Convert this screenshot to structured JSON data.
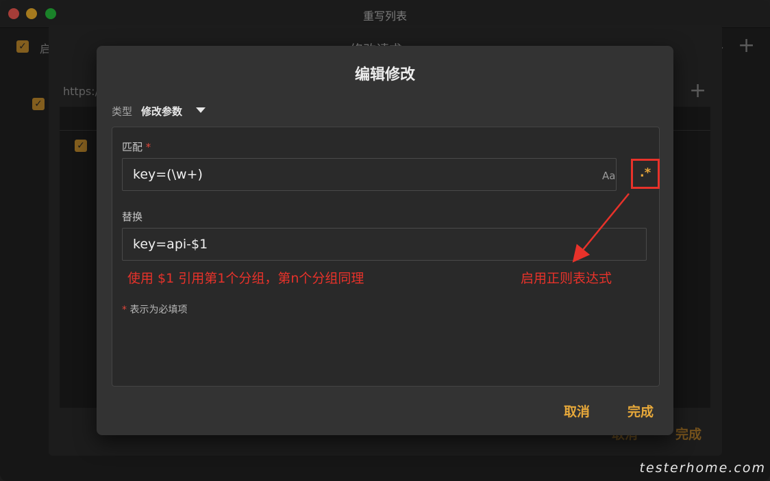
{
  "window": {
    "title": "重写列表"
  },
  "background": {
    "enable_label": "启",
    "url_label": "https:/",
    "trailing_label": "分",
    "ghost_cancel": "取消",
    "ghost_done": "完成",
    "sheet_title": "修改请求"
  },
  "dialog": {
    "title": "编辑修改",
    "type_label": "类型",
    "type_value": "修改参数",
    "match_label": "匹配",
    "required_mark": "*",
    "match_value": "key=(\\w+)",
    "case_toggle": "Aa",
    "regex_toggle": ".*",
    "replace_label": "替换",
    "replace_value": "key=api-$1",
    "required_note": "表示为必填项",
    "cancel_label": "取消",
    "done_label": "完成"
  },
  "annotations": {
    "left_note": "使用 $1 引用第1个分组，第n个分组同理",
    "right_note": "启用正则表达式",
    "highlight_color": "#e8322a"
  },
  "colors": {
    "accent": "#e8a93a",
    "checkbox": "#c9912e"
  },
  "watermark": "testerhome.com"
}
